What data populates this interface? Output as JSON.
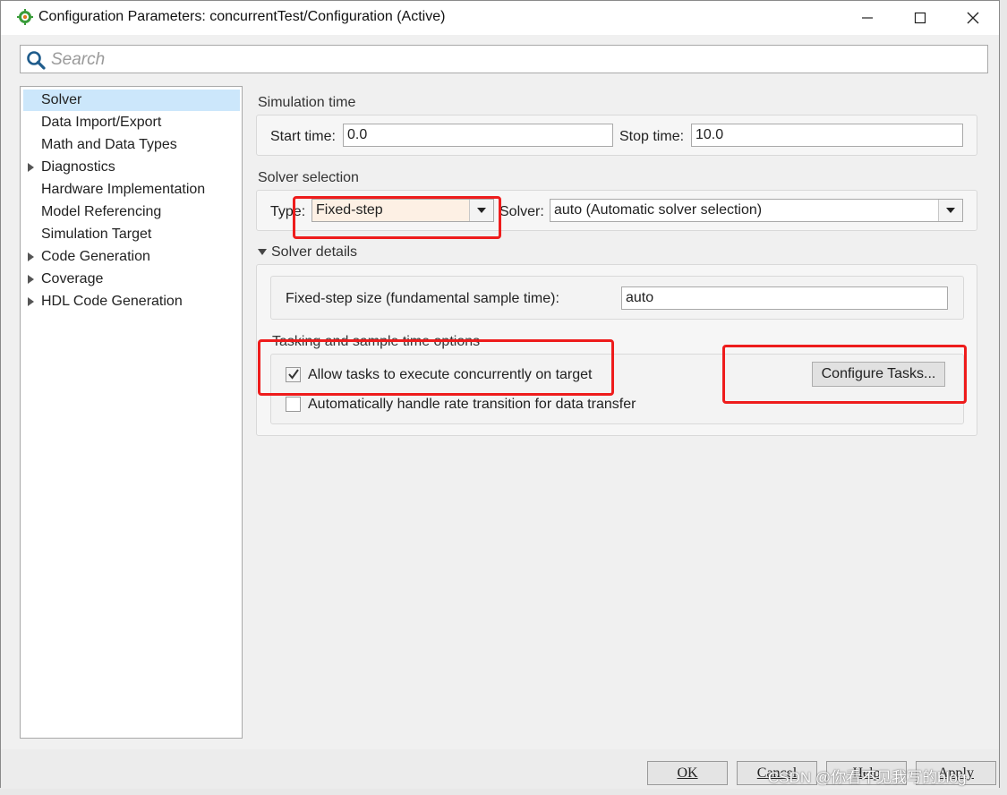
{
  "window": {
    "title": "Configuration Parameters: concurrentTest/Configuration (Active)"
  },
  "search": {
    "placeholder": "Search"
  },
  "sidebar": {
    "items": [
      {
        "label": "Solver",
        "expandable": false,
        "selected": true
      },
      {
        "label": "Data Import/Export",
        "expandable": false
      },
      {
        "label": "Math and Data Types",
        "expandable": false
      },
      {
        "label": "Diagnostics",
        "expandable": true
      },
      {
        "label": "Hardware Implementation",
        "expandable": false
      },
      {
        "label": "Model Referencing",
        "expandable": false
      },
      {
        "label": "Simulation Target",
        "expandable": false
      },
      {
        "label": "Code Generation",
        "expandable": true
      },
      {
        "label": "Coverage",
        "expandable": true
      },
      {
        "label": "HDL Code Generation",
        "expandable": true
      }
    ]
  },
  "simulation_time": {
    "section_label": "Simulation time",
    "start_label": "Start time:",
    "start_value": "0.0",
    "stop_label": "Stop time:",
    "stop_value": "10.0"
  },
  "solver_selection": {
    "section_label": "Solver selection",
    "type_label": "Type:",
    "type_value": "Fixed-step",
    "solver_label": "Solver:",
    "solver_value": "auto (Automatic solver selection)"
  },
  "solver_details": {
    "section_label": "Solver details",
    "step_size_label": "Fixed-step size (fundamental sample time):",
    "step_size_value": "auto"
  },
  "tasking": {
    "section_label": "Tasking and sample time options",
    "concurrent_label": "Allow tasks to execute concurrently on target",
    "concurrent_checked": true,
    "rate_transition_label": "Automatically handle rate transition for data transfer",
    "rate_transition_checked": false,
    "configure_button": "Configure Tasks..."
  },
  "footer": {
    "ok": "OK",
    "cancel": "Cancel",
    "help": "Help",
    "apply": "Apply"
  },
  "watermark": "CSDN @你看不见我写的blog",
  "colors": {
    "highlight_red": "#ee1c1c",
    "selected_item": "#cce7fb",
    "fixed_step_field": "#fdf0e4"
  }
}
